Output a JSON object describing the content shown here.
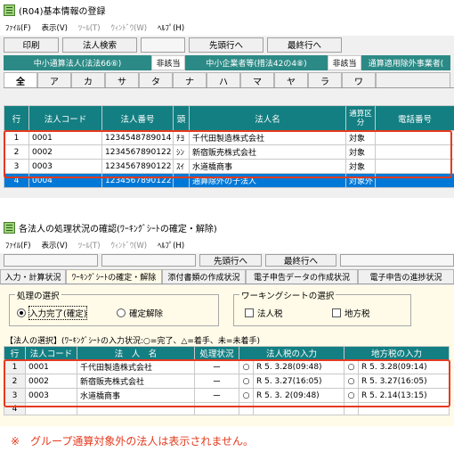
{
  "win1": {
    "title": "(R04)基本情報の登録",
    "menu": [
      "ﾌｧｲﾙ(F)",
      "表示(V)",
      "ﾂｰﾙ(T)",
      "ｳｨﾝﾄﾞｳ(W)",
      "ﾍﾙﾌﾟ(H)"
    ],
    "toolbar": [
      "印刷",
      "法人検索",
      "",
      "先頭行へ",
      "最終行へ"
    ],
    "greenbar": [
      {
        "label": "中小通算法人(法法66⑥)",
        "kind": "green"
      },
      {
        "label": "非該当",
        "kind": "white"
      },
      {
        "label": "中小企業者等(措法42の4⑧)",
        "kind": "green"
      },
      {
        "label": "非該当",
        "kind": "white"
      },
      {
        "label": "通算適用除外事業者(",
        "kind": "green"
      }
    ],
    "kana_tabs": [
      "全",
      "ア",
      "カ",
      "サ",
      "タ",
      "ナ",
      "ハ",
      "マ",
      "ヤ",
      "ラ",
      "ワ",
      ""
    ],
    "columns": [
      "行",
      "法人コード",
      "法人番号",
      "頭",
      "法人名",
      "通算区分",
      "電話番号"
    ],
    "rows": [
      {
        "no": "1",
        "code": "0001",
        "number": "1234548789014",
        "head": "ﾁﾖ",
        "name": "千代田製造株式会社",
        "kubun": "対象",
        "tel": ""
      },
      {
        "no": "2",
        "code": "0002",
        "number": "1234567890122",
        "head": "ｼﾝ",
        "name": "新宿販売株式会社",
        "kubun": "対象",
        "tel": ""
      },
      {
        "no": "3",
        "code": "0003",
        "number": "1234567890122",
        "head": "ｽｲ",
        "name": "水道橋商事",
        "kubun": "対象",
        "tel": ""
      },
      {
        "no": "4",
        "code": "0004",
        "number": "1234567890122",
        "head": "",
        "name": "通算除外の子法人",
        "kubun": "対象外",
        "tel": ""
      }
    ]
  },
  "win2": {
    "title": "各法人の処理状況の確認(ﾜｰｷﾝｸﾞｼｰﾄの確定・解除)",
    "menu": [
      "ﾌｧｲﾙ(F)",
      "表示(V)",
      "ﾂｰﾙ(T)",
      "ｳｨﾝﾄﾞｳ(W)",
      "ﾍﾙﾌﾟ(H)"
    ],
    "toolbar": [
      "",
      "",
      "先頭行へ",
      "最終行へ",
      ""
    ],
    "tabs": [
      "入力・計算状況",
      "ﾜｰｷﾝｸﾞｼｰﾄの確定・解除",
      "添付書類の作成状況",
      "電子申告データの作成状況",
      "電子申告の進捗状況"
    ],
    "process_group": {
      "legend": "処理の選択",
      "options": [
        {
          "label": "入力完了(確定)",
          "checked": true
        },
        {
          "label": "確定解除",
          "checked": false
        }
      ]
    },
    "worksheet_group": {
      "legend": "ワーキングシートの選択",
      "options": [
        {
          "label": "法人税",
          "checked": false
        },
        {
          "label": "地方税",
          "checked": false
        }
      ]
    },
    "selection_caption": "【法人の選択】(ﾜｰｷﾝｸﾞｼｰﾄの入力状況:○=完了、△=着手、未=未着手)",
    "columns": [
      "行",
      "法人コード",
      "法　人　名",
      "処理状況",
      "法人税の入力",
      "地方税の入力"
    ],
    "rows": [
      {
        "no": "1",
        "code": "0001",
        "name": "千代田製造株式会社",
        "status": "ー",
        "corp_mark": "○",
        "corp_date": "R 5. 3.28(09:48)",
        "local_mark": "○",
        "local_date": "R 5. 3.28(09:14)"
      },
      {
        "no": "2",
        "code": "0002",
        "name": "新宿販売株式会社",
        "status": "ー",
        "corp_mark": "○",
        "corp_date": "R 5. 3.27(16:05)",
        "local_mark": "○",
        "local_date": "R 5. 3.27(16:05)"
      },
      {
        "no": "3",
        "code": "0003",
        "name": "水道橋商事",
        "status": "ー",
        "corp_mark": "○",
        "corp_date": "R 5. 3. 2(09:48)",
        "local_mark": "○",
        "local_date": "R 5. 2.14(13:15)"
      },
      {
        "no": "4",
        "code": "",
        "name": "",
        "status": "",
        "corp_mark": "",
        "corp_date": "",
        "local_mark": "",
        "local_date": ""
      }
    ]
  },
  "note": "※　グループ通算対象外の法人は表示されません。",
  "colors": {
    "teal": "#137f82",
    "green_bar": "#2c8a86",
    "selected": "#0078d7",
    "highlight_box": "#e53a1e",
    "panel": "#fffbe8"
  }
}
